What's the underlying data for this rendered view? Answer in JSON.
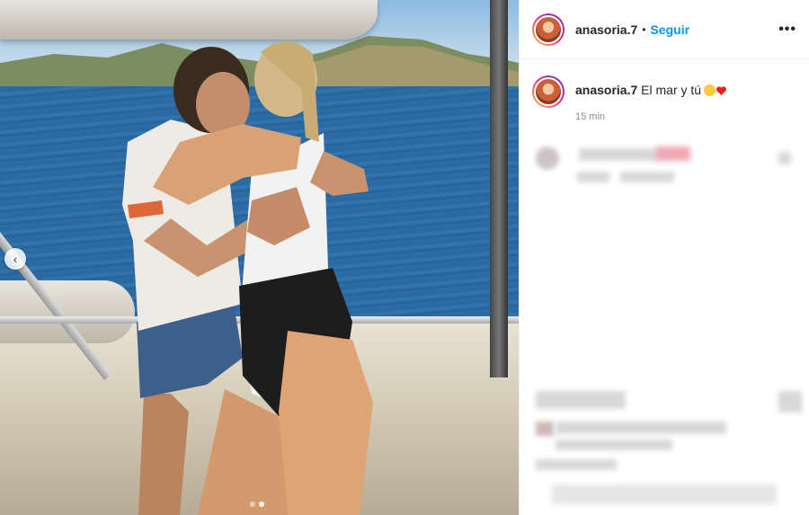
{
  "post": {
    "username": "anasoria.7",
    "follow_label": "Seguir",
    "separator": "•",
    "more_label": "•••",
    "caption_text": "El mar y tú",
    "caption_emojis": [
      "smiling-face",
      "red-heart"
    ],
    "timestamp": "15 min"
  },
  "carousel": {
    "prev_icon": "chevron-left-icon",
    "prev_glyph": "‹",
    "slide_count": 2,
    "active_slide": 2
  },
  "colors": {
    "accent": "#0095f6",
    "meta": "#8e8e8e",
    "heart": "#ed1c24"
  }
}
